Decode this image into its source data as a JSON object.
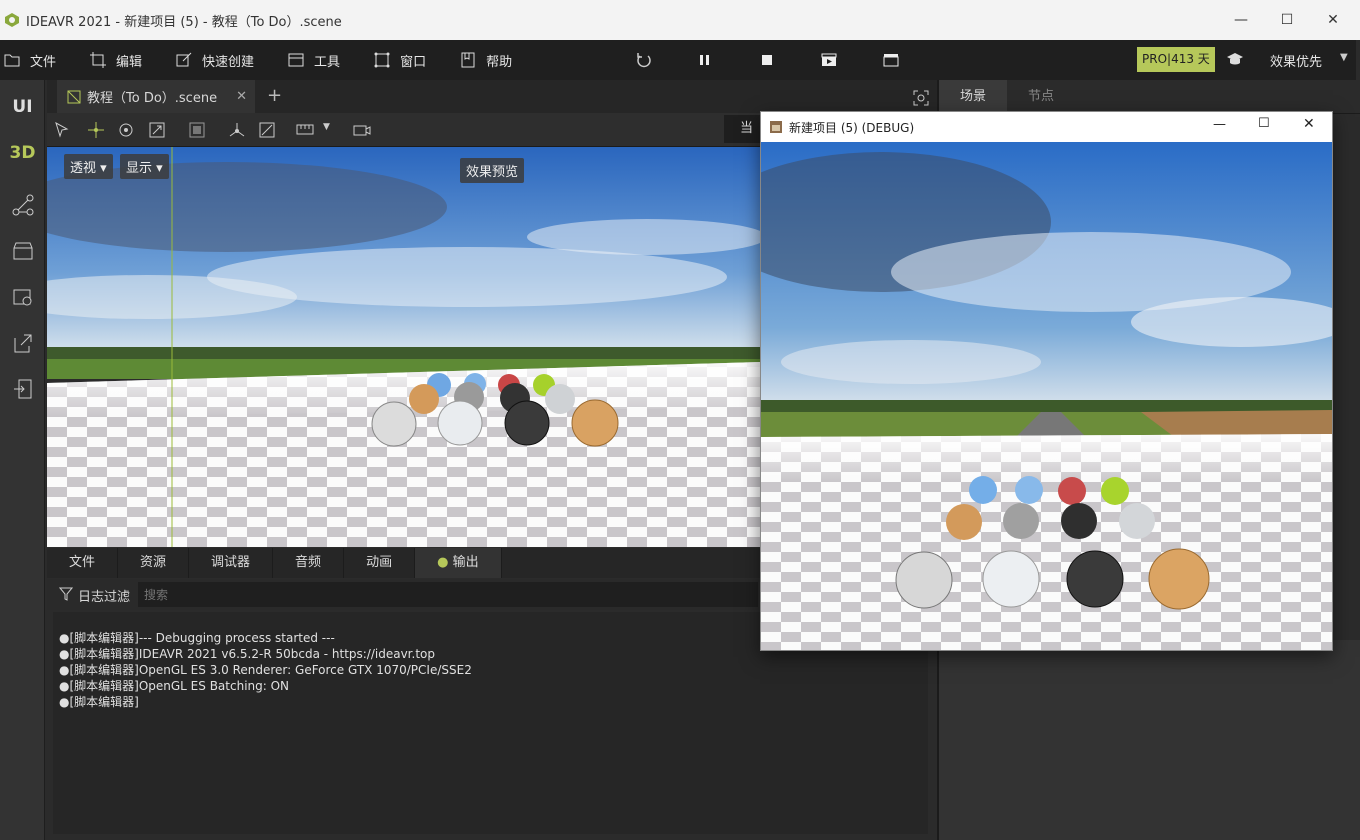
{
  "window": {
    "title": "IDEAVR 2021 - 新建项目 (5) - 教程（To Do）.scene",
    "minimize": "—",
    "maximize": "☐",
    "close": "✕"
  },
  "menu": {
    "items": [
      "文件",
      "编辑",
      "快速创建",
      "工具",
      "窗口",
      "帮助"
    ]
  },
  "header": {
    "pro_badge": "PRO|413 天",
    "quality": "效果优先"
  },
  "sidebar": {
    "ui_label": "UI",
    "3d_label": "3D"
  },
  "editor": {
    "tab_label": "教程（To Do）.scene",
    "current_label": "当前",
    "view_mode": "透视",
    "display": "显示",
    "preview": "效果预览"
  },
  "bottom": {
    "tabs": [
      "文件",
      "资源",
      "调试器",
      "音频",
      "动画",
      "输出"
    ],
    "filter_label": "日志过滤",
    "search_placeholder": "搜索",
    "logs": [
      "●[脚本编辑器]--- Debugging process started ---",
      "●[脚本编辑器]IDEAVR 2021 v6.5.2-R 50bcda - https://ideavr.top",
      "●[脚本编辑器]OpenGL ES 3.0 Renderer: GeForce GTX 1070/PCIe/SSE2",
      "●[脚本编辑器]OpenGL ES Batching: ON",
      "●[脚本编辑器]"
    ]
  },
  "right_panel": {
    "tabs": [
      "场景",
      "节点"
    ]
  },
  "debug_window": {
    "title": "新建项目 (5) (DEBUG)"
  },
  "colors": {
    "accent": "#b6c85a",
    "menubar": "#1f1f1f",
    "panel": "#2b2b2b",
    "sky_top": "#2f6fc2",
    "ground": "#ffffff"
  }
}
